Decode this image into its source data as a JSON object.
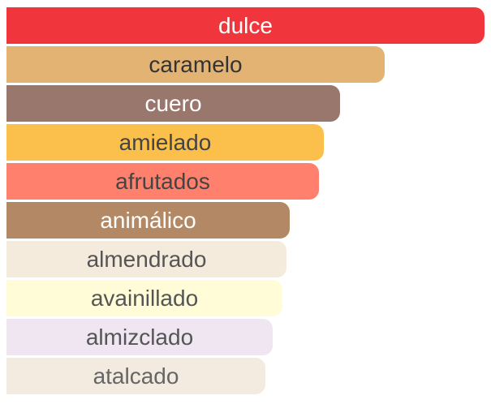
{
  "chart_data": {
    "type": "bar",
    "orientation": "horizontal",
    "categories": [
      "dulce",
      "caramelo",
      "cuero",
      "amielado",
      "afrutados",
      "animálico",
      "almendrado",
      "avainillado",
      "almizclado",
      "atalcado"
    ],
    "values": [
      100,
      79.2,
      69.8,
      66.4,
      65.4,
      59.3,
      58.6,
      57.7,
      55.7,
      54.1
    ],
    "colors": [
      "#F0353C",
      "#E3B374",
      "#9A776D",
      "#FBC04C",
      "#FF806C",
      "#B38864",
      "#F5EBDC",
      "#FFFCD7",
      "#EFE6F2",
      "#F3EAE0"
    ],
    "label_colors": [
      "#ffffff",
      "#333333",
      "#ffffff",
      "#444444",
      "#444444",
      "#ffffff",
      "#555555",
      "#555555",
      "#555555",
      "#666666"
    ]
  }
}
